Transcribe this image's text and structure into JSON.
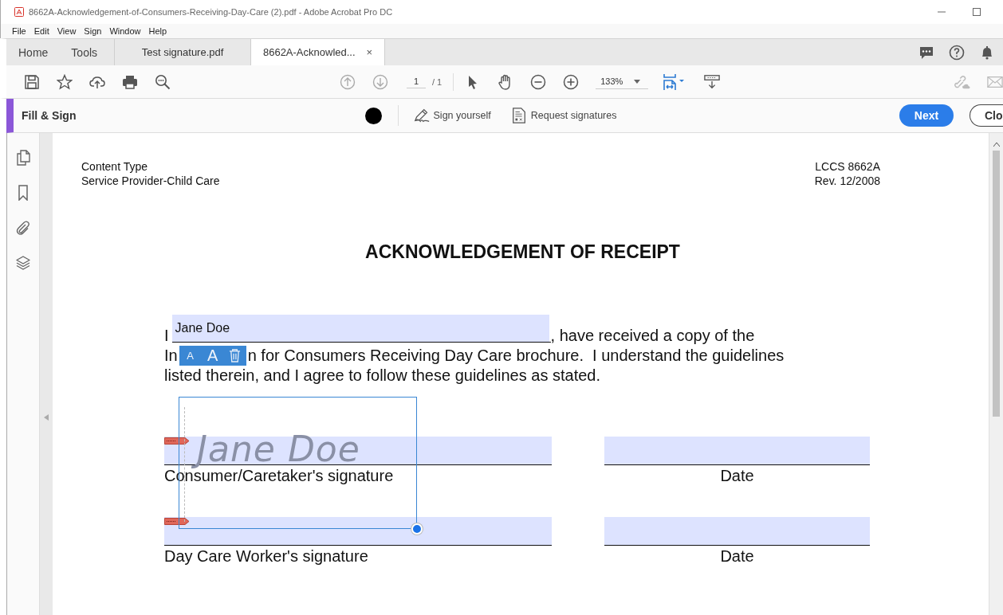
{
  "window": {
    "title": "8662A-Acknowledgement-of-Consumers-Receiving-Day-Care (2).pdf - Adobe Acrobat Pro DC"
  },
  "menu": [
    "File",
    "Edit",
    "View",
    "Sign",
    "Window",
    "Help"
  ],
  "nav": [
    {
      "label": "Home",
      "selected": false
    },
    {
      "label": "Tools",
      "selected": false
    }
  ],
  "tabs": [
    {
      "label": "Test signature.pdf",
      "selected": false
    },
    {
      "label": "8662A-Acknowled...",
      "selected": true,
      "close": "×"
    }
  ],
  "toolbar": {
    "page": "1",
    "page_total": "/ 1",
    "zoom": "133%"
  },
  "fill_sign": {
    "title": "Fill & Sign",
    "actions": [
      "Sign yourself",
      "Request signatures"
    ],
    "next": "Next",
    "close": "Clo"
  },
  "document": {
    "header_left": [
      "Content Type",
      "Service Provider-Child Care"
    ],
    "header_right": [
      "LCCS 8662A",
      "Rev. 12/2008"
    ],
    "title": "ACKNOWLEDGEMENT OF RECEIPT",
    "paragraph": {
      "line1_start": "I",
      "line1_end": ", have received a copy of the",
      "line2_start": "In",
      "line2_end": "n for Consumers Receiving Day Care brochure.  I understand the guidelines",
      "line3": "listed therein, and I agree to follow these guidelines as stated."
    },
    "name_field": {
      "value": "Jane Doe"
    },
    "text_tools": {
      "smaller": "A",
      "larger": "A"
    },
    "signature": "Jane Doe",
    "rows": [
      {
        "sign_label": "Consumer/Caretaker's signature",
        "date_label": "Date"
      },
      {
        "sign_label": "Day Care Worker's signature",
        "date_label": "Date"
      }
    ]
  }
}
